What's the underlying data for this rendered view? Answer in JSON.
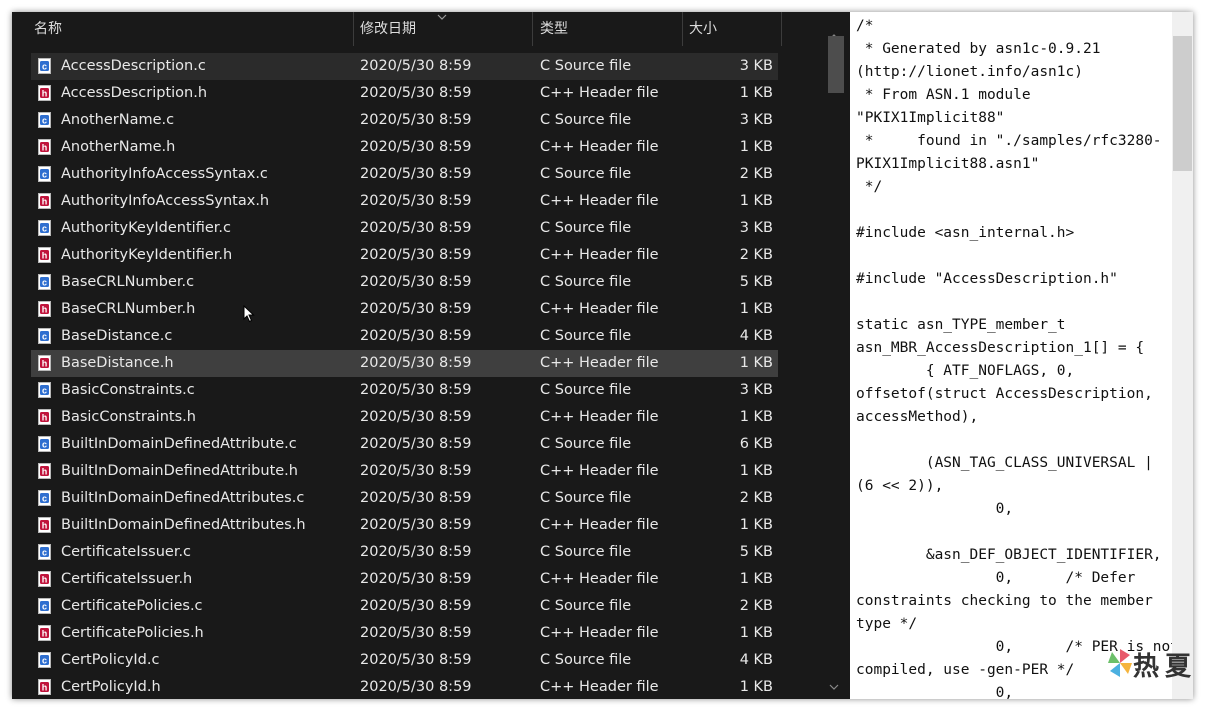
{
  "header": {
    "name": "名称",
    "date": "修改日期",
    "type": "类型",
    "size": "大小"
  },
  "files": [
    {
      "name": "AccessDescription.c",
      "date": "2020/5/30 8:59",
      "type": "C Source file",
      "size": "3 KB",
      "kind": "c",
      "state": "hover"
    },
    {
      "name": "AccessDescription.h",
      "date": "2020/5/30 8:59",
      "type": "C++ Header file",
      "size": "1 KB",
      "kind": "h"
    },
    {
      "name": "AnotherName.c",
      "date": "2020/5/30 8:59",
      "type": "C Source file",
      "size": "3 KB",
      "kind": "c"
    },
    {
      "name": "AnotherName.h",
      "date": "2020/5/30 8:59",
      "type": "C++ Header file",
      "size": "1 KB",
      "kind": "h"
    },
    {
      "name": "AuthorityInfoAccessSyntax.c",
      "date": "2020/5/30 8:59",
      "type": "C Source file",
      "size": "2 KB",
      "kind": "c"
    },
    {
      "name": "AuthorityInfoAccessSyntax.h",
      "date": "2020/5/30 8:59",
      "type": "C++ Header file",
      "size": "1 KB",
      "kind": "h"
    },
    {
      "name": "AuthorityKeyIdentifier.c",
      "date": "2020/5/30 8:59",
      "type": "C Source file",
      "size": "3 KB",
      "kind": "c"
    },
    {
      "name": "AuthorityKeyIdentifier.h",
      "date": "2020/5/30 8:59",
      "type": "C++ Header file",
      "size": "2 KB",
      "kind": "h"
    },
    {
      "name": "BaseCRLNumber.c",
      "date": "2020/5/30 8:59",
      "type": "C Source file",
      "size": "5 KB",
      "kind": "c"
    },
    {
      "name": "BaseCRLNumber.h",
      "date": "2020/5/30 8:59",
      "type": "C++ Header file",
      "size": "1 KB",
      "kind": "h"
    },
    {
      "name": "BaseDistance.c",
      "date": "2020/5/30 8:59",
      "type": "C Source file",
      "size": "4 KB",
      "kind": "c"
    },
    {
      "name": "BaseDistance.h",
      "date": "2020/5/30 8:59",
      "type": "C++ Header file",
      "size": "1 KB",
      "kind": "h",
      "state": "selected"
    },
    {
      "name": "BasicConstraints.c",
      "date": "2020/5/30 8:59",
      "type": "C Source file",
      "size": "3 KB",
      "kind": "c"
    },
    {
      "name": "BasicConstraints.h",
      "date": "2020/5/30 8:59",
      "type": "C++ Header file",
      "size": "1 KB",
      "kind": "h"
    },
    {
      "name": "BuiltInDomainDefinedAttribute.c",
      "date": "2020/5/30 8:59",
      "type": "C Source file",
      "size": "6 KB",
      "kind": "c"
    },
    {
      "name": "BuiltInDomainDefinedAttribute.h",
      "date": "2020/5/30 8:59",
      "type": "C++ Header file",
      "size": "1 KB",
      "kind": "h"
    },
    {
      "name": "BuiltInDomainDefinedAttributes.c",
      "date": "2020/5/30 8:59",
      "type": "C Source file",
      "size": "2 KB",
      "kind": "c"
    },
    {
      "name": "BuiltInDomainDefinedAttributes.h",
      "date": "2020/5/30 8:59",
      "type": "C++ Header file",
      "size": "1 KB",
      "kind": "h"
    },
    {
      "name": "CertificateIssuer.c",
      "date": "2020/5/30 8:59",
      "type": "C Source file",
      "size": "5 KB",
      "kind": "c"
    },
    {
      "name": "CertificateIssuer.h",
      "date": "2020/5/30 8:59",
      "type": "C++ Header file",
      "size": "1 KB",
      "kind": "h"
    },
    {
      "name": "CertificatePolicies.c",
      "date": "2020/5/30 8:59",
      "type": "C Source file",
      "size": "2 KB",
      "kind": "c"
    },
    {
      "name": "CertificatePolicies.h",
      "date": "2020/5/30 8:59",
      "type": "C++ Header file",
      "size": "1 KB",
      "kind": "h"
    },
    {
      "name": "CertPolicyId.c",
      "date": "2020/5/30 8:59",
      "type": "C Source file",
      "size": "4 KB",
      "kind": "c"
    },
    {
      "name": "CertPolicyId.h",
      "date": "2020/5/30 8:59",
      "type": "C++ Header file",
      "size": "1 KB",
      "kind": "h"
    }
  ],
  "preview": {
    "lines": [
      "/*",
      " * Generated by asn1c-0.9.21",
      "(http://lionet.info/asn1c)",
      " * From ASN.1 module",
      "\"PKIX1Implicit88\"",
      " *     found in \"./samples/rfc3280-",
      "PKIX1Implicit88.asn1\"",
      " */",
      "",
      "#include <asn_internal.h>",
      "",
      "#include \"AccessDescription.h\"",
      "",
      "static asn_TYPE_member_t",
      "asn_MBR_AccessDescription_1[] = {",
      "        { ATF_NOFLAGS, 0,",
      "offsetof(struct AccessDescription,",
      "accessMethod),",
      "",
      "        (ASN_TAG_CLASS_UNIVERSAL |",
      "(6 << 2)),",
      "                0,",
      "",
      "        &asn_DEF_OBJECT_IDENTIFIER,",
      "                0,      /* Defer",
      "constraints checking to the member",
      "type */",
      "                0,      /* PER is not",
      "compiled, use -gen-PER */",
      "                0,"
    ]
  },
  "watermark": {
    "text": "热夏"
  },
  "colors": {
    "window_bg": "#191919",
    "selected_row": "#3f3f3f",
    "hover_row": "#2b2b2b",
    "c_icon": "#2f6fd0",
    "h_icon": "#c0143c"
  }
}
